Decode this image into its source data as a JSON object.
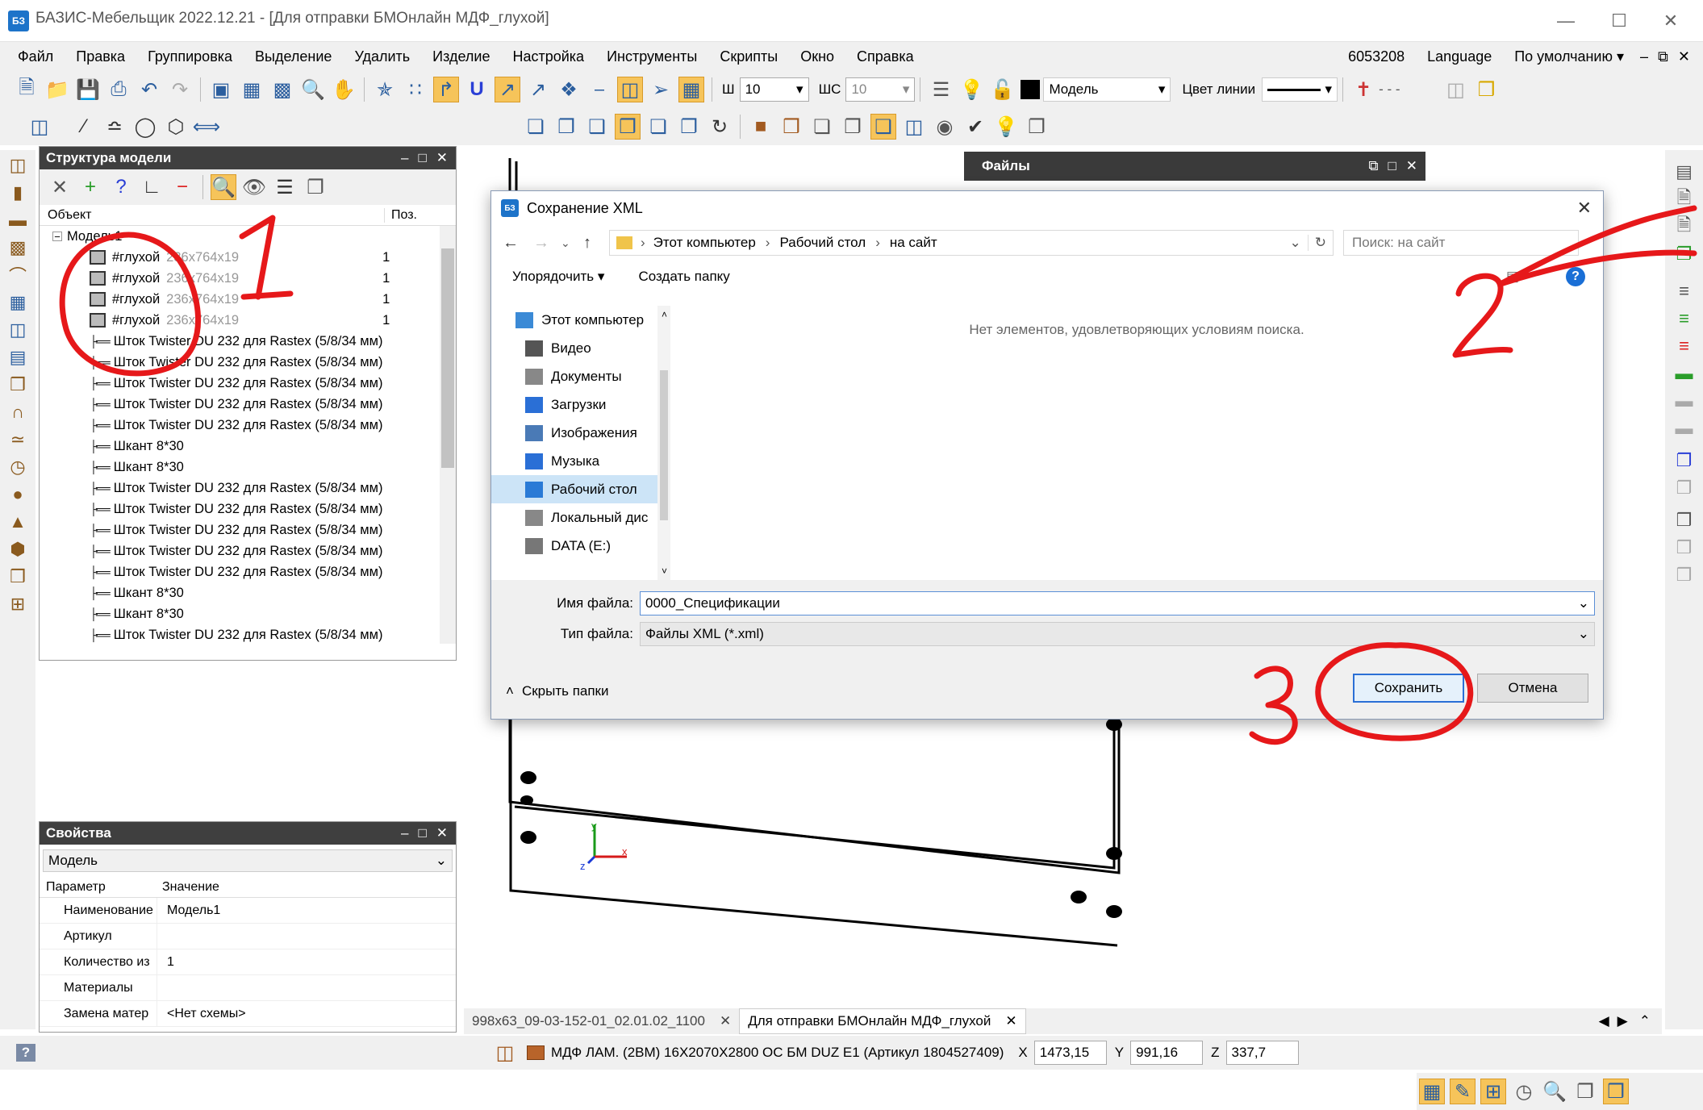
{
  "window": {
    "title": "БАЗИС-Мебельщик 2022.12.21 - [Для отправки БМОнлайн МДФ_глухой]",
    "app_icon": "БЗ"
  },
  "menu": [
    "Файл",
    "Правка",
    "Группировка",
    "Выделение",
    "Удалить",
    "Изделие",
    "Настройка",
    "Инструменты",
    "Скрипты",
    "Окно",
    "Справка"
  ],
  "menu_right": {
    "code": "6053208",
    "language": "Language",
    "preset": "По умолчанию"
  },
  "toolbar": {
    "width_label": "Ш",
    "width_value": "10",
    "step_label": "ШС",
    "step_value": "10",
    "layer_value": "Модель",
    "line_color_label": "Цвет линии"
  },
  "structure": {
    "title": "Структура модели",
    "col_object": "Объект",
    "col_pos": "Поз.",
    "root": "Модель1",
    "panels": [
      {
        "name": "#глухой",
        "dims": "236x764x19",
        "pos": "1"
      },
      {
        "name": "#глухой",
        "dims": "236x764x19",
        "pos": "1"
      },
      {
        "name": "#глухой",
        "dims": "236x764x19",
        "pos": "1"
      },
      {
        "name": "#глухой",
        "dims": "236x764x19",
        "pos": "1"
      }
    ],
    "hardware": [
      "Шток Twister DU 232 для Rastex (5/8/34 мм)",
      "Шток Twister DU 232 для Rastex (5/8/34 мм)",
      "Шток Twister DU 232 для Rastex (5/8/34 мм)",
      "Шток Twister DU 232 для Rastex (5/8/34 мм)",
      "Шток Twister DU 232 для Rastex (5/8/34 мм)",
      "Шкант 8*30",
      "Шкант 8*30",
      "Шток Twister DU 232 для Rastex (5/8/34 мм)",
      "Шток Twister DU 232 для Rastex (5/8/34 мм)",
      "Шток Twister DU 232 для Rastex (5/8/34 мм)",
      "Шток Twister DU 232 для Rastex (5/8/34 мм)",
      "Шток Twister DU 232 для Rastex (5/8/34 мм)",
      "Шкант 8*30",
      "Шкант 8*30",
      "Шток Twister DU 232 для Rastex (5/8/34 мм)"
    ]
  },
  "properties": {
    "title": "Свойства",
    "selector": "Модель",
    "col_param": "Параметр",
    "col_value": "Значение",
    "rows": [
      {
        "param": "Наименование",
        "value": "Модель1"
      },
      {
        "param": "Артикул",
        "value": ""
      },
      {
        "param": "Количество из",
        "value": "1"
      },
      {
        "param": "Материалы",
        "value": ""
      },
      {
        "param": "Замена матер",
        "value": "<Нет схемы>"
      }
    ]
  },
  "files_panel": {
    "title": "Файлы"
  },
  "dialog": {
    "title": "Сохранение XML",
    "breadcrumb": [
      "Этот компьютер",
      "Рабочий стол",
      "на сайт"
    ],
    "search_placeholder": "Поиск: на сайт",
    "organize": "Упорядочить",
    "new_folder": "Создать папку",
    "nav": [
      "Этот компьютер",
      "Видео",
      "Документы",
      "Загрузки",
      "Изображения",
      "Музыка",
      "Рабочий стол",
      "Локальный дис",
      "DATA (E:)"
    ],
    "empty_message": "Нет элементов, удовлетворяющих условиям поиска.",
    "filename_label": "Имя файла:",
    "filename_value": "0000_Спецификации",
    "filetype_label": "Тип файла:",
    "filetype_value": "Файлы XML (*.xml)",
    "hide_folders": "Скрыть папки",
    "save": "Сохранить",
    "cancel": "Отмена"
  },
  "tabs": [
    "998x63_09-03-152-01_02.01.02_1100",
    "Для отправки БМОнлайн МДФ_глухой"
  ],
  "status": {
    "material": "МДФ ЛАМ. (2ВМ) 16Х2070Х2800 ОС БМ DUZ E1 (Артикул 1804527409)",
    "x_label": "X",
    "x": "1473,15",
    "y_label": "Y",
    "y": "991,16",
    "z_label": "Z",
    "z": "337,7"
  },
  "annotations": {
    "one": "1",
    "two": "2",
    "three": "3",
    "color": "#e6181a"
  },
  "axis": {
    "y": "y",
    "z": "z",
    "x": "x"
  }
}
